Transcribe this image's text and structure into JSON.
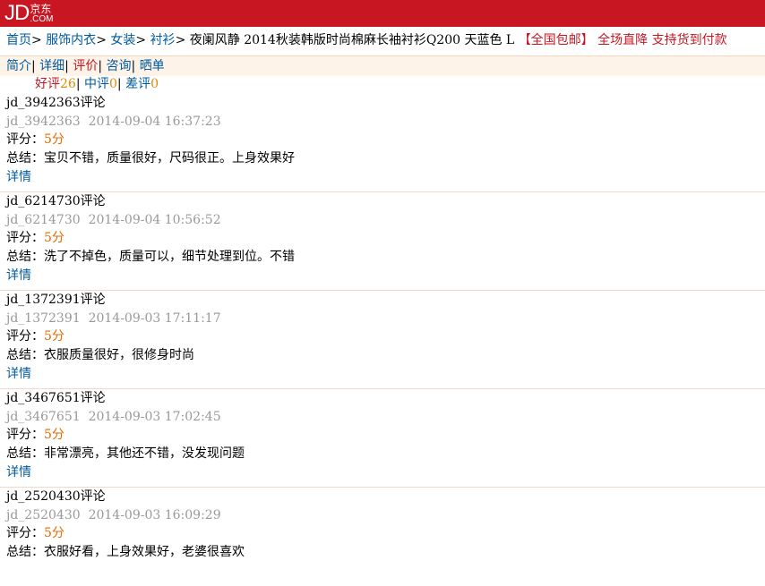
{
  "logo": {
    "jd": "JD",
    "cn": "京东",
    "com": ".COM"
  },
  "breadcrumb": {
    "items": [
      "首页",
      "服饰内衣",
      "女装",
      "衬衫"
    ],
    "product_title": "夜阑风静 2014秋装韩版时尚棉麻长袖衬衫Q200 天蓝色 L",
    "promo_free_shipping": "【全国包邮】",
    "promo_sale": "全场直降",
    "promo_cod": "支持货到付款"
  },
  "tabs": [
    "简介",
    "详细",
    "评价",
    "咨询",
    "晒单"
  ],
  "active_tab": "评价",
  "counts": {
    "good_label": "好评",
    "good": "26",
    "mid_label": "中评",
    "mid": "0",
    "bad_label": "差评",
    "bad": "0"
  },
  "labels": {
    "score": "评分：",
    "summary": "总结：",
    "detail": "详情",
    "comment_suffix": "评论"
  },
  "reviews": [
    {
      "user": "jd_3942363",
      "date": "2014-09-04 16:37:23",
      "score": "5分",
      "summary": "宝贝不错，质量很好，尺码很正。上身效果好"
    },
    {
      "user": "jd_6214730",
      "date": "2014-09-04 10:56:52",
      "score": "5分",
      "summary": "洗了不掉色，质量可以，细节处理到位。不错"
    },
    {
      "user": "jd_1372391",
      "date": "2014-09-03 17:11:17",
      "score": "5分",
      "summary": "衣服质量很好，很修身时尚"
    },
    {
      "user": "jd_3467651",
      "date": "2014-09-03 17:02:45",
      "score": "5分",
      "summary": "非常漂亮，其他还不错，没发现问题"
    },
    {
      "user": "jd_2520430",
      "date": "2014-09-03 16:09:29",
      "score": "5分",
      "summary": "衣服好看，上身效果好，老婆很喜欢"
    }
  ]
}
